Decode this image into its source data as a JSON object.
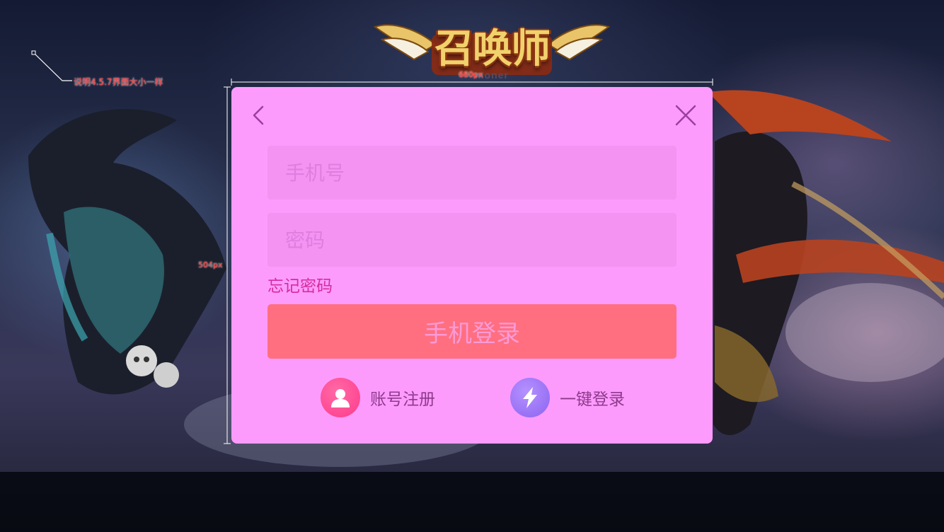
{
  "annotations": {
    "note": "说明4.5.7界面大小一样",
    "width_label": "680px",
    "height_label": "504px"
  },
  "logo": {
    "title": "召唤师",
    "subtitle": "moner"
  },
  "dialog": {
    "phone_placeholder": "手机号",
    "password_placeholder": "密码",
    "forgot_password": "忘记密码",
    "login_button": "手机登录",
    "register_label": "账号注册",
    "quick_login_label": "一键登录"
  },
  "icons": {
    "back": "chevron-left-icon",
    "close": "close-icon",
    "register": "user-icon",
    "quick_login": "lightning-icon"
  },
  "colors": {
    "dialog_bg": "#fd9bfd",
    "field_bg": "#f593f2",
    "login_button_bg": "#ff6f80",
    "forgot_link": "#d62c9d",
    "register_icon_bg": "#ff3a8a",
    "quick_icon_bg": "#8c63f0"
  }
}
